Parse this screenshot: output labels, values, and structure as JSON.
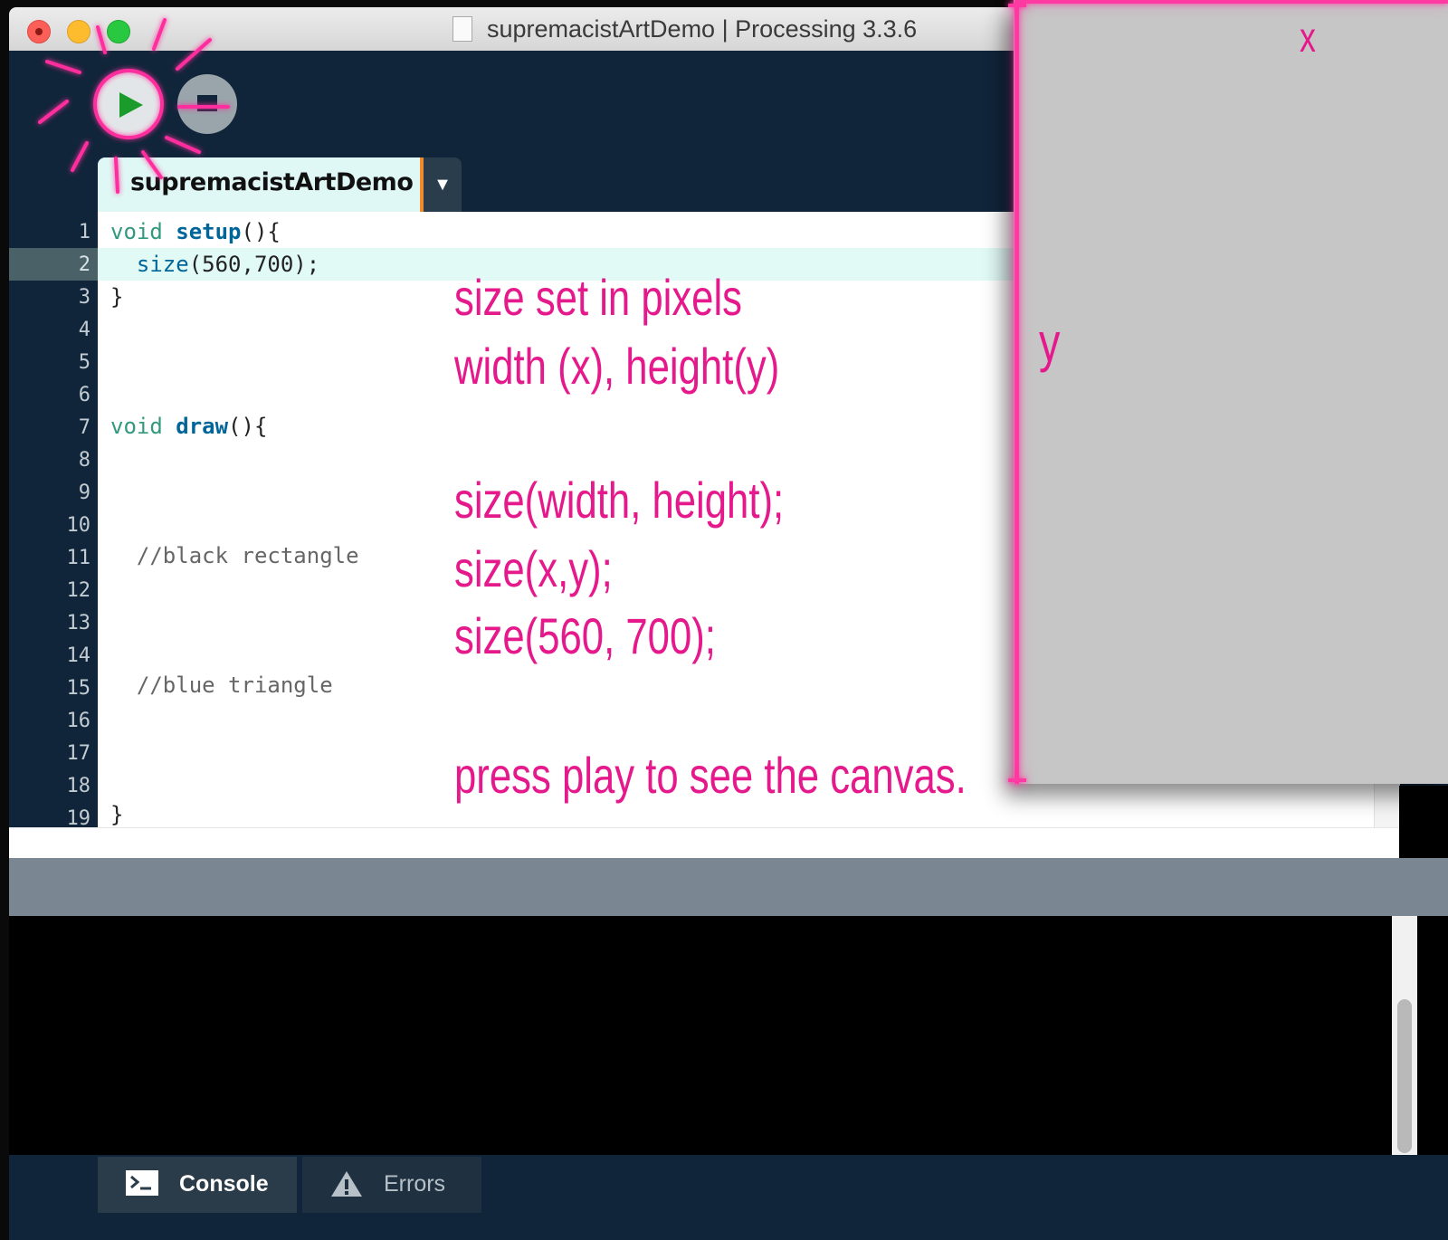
{
  "window": {
    "title": "supremacistArtDemo | Processing 3.3.6"
  },
  "toolbar": {
    "run_icon": "play-icon",
    "stop_icon": "stop-icon"
  },
  "editor": {
    "tab_label": "supremacistArtDemo",
    "tab_menu_icon": "triangle-down-icon",
    "line_numbers": [
      "1",
      "2",
      "3",
      "4",
      "5",
      "6",
      "7",
      "8",
      "9",
      "10",
      "11",
      "12",
      "13",
      "14",
      "15",
      "16",
      "17",
      "18",
      "19"
    ],
    "lines": {
      "l1_kw": "void",
      "l1_fn": "setup",
      "l1_rest": "(){",
      "l2_indent": "  ",
      "l2_call": "size",
      "l2_rest": "(560,700);",
      "l3": "}",
      "l7_kw": "void",
      "l7_fn": "draw",
      "l7_rest": "(){",
      "l11": "  //black rectangle",
      "l15": "  //blue triangle",
      "l19": "}"
    }
  },
  "annotations": {
    "line1": "size set in pixels",
    "line2": "width (x), height(y)",
    "line3": "size(width, height);",
    "line4": "size(x,y);",
    "line5": "size(560, 700);",
    "line6": "press play to see the canvas.",
    "x_label": "x",
    "y_label": "y"
  },
  "console_tabs": {
    "console_label": "Console",
    "errors_label": "Errors",
    "console_icon": "terminal-icon",
    "errors_icon": "warning-icon"
  },
  "colors": {
    "annotation": "#e5198b",
    "keyword": "#33997e",
    "function": "#006699",
    "tab_accent": "#f18a2a"
  }
}
